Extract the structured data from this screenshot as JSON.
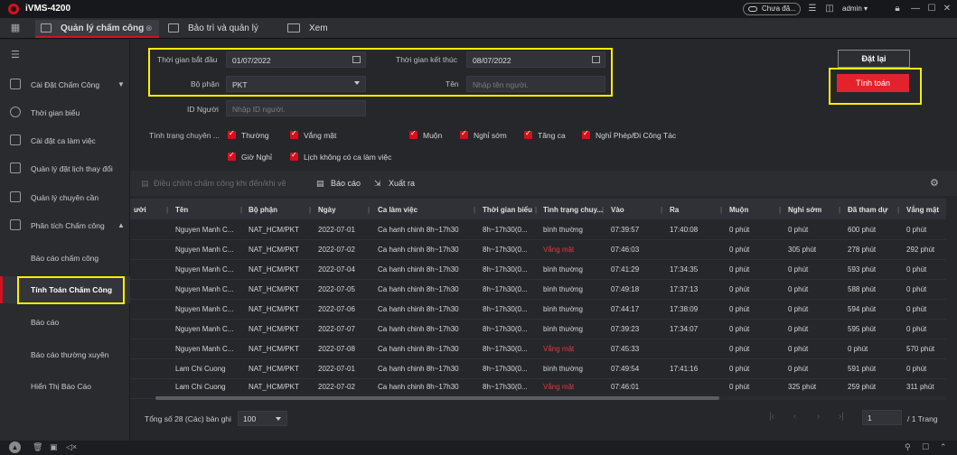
{
  "app": {
    "title": "iVMS-4200"
  },
  "titlebar": {
    "cloud_label": "Chưa đă...",
    "user": "admin"
  },
  "tabs": [
    {
      "label": "Quản lý chấm công"
    },
    {
      "label": "Bảo trì và quản lý"
    },
    {
      "label": "Xem"
    }
  ],
  "sidebar": {
    "items": [
      {
        "label": "Cài Đặt Chấm Công"
      },
      {
        "label": "Thời gian biểu"
      },
      {
        "label": "Cài đặt ca làm việc"
      },
      {
        "label": "Quản lý đặt lịch thay đổi"
      },
      {
        "label": "Quản lý chuyên cần"
      },
      {
        "label": "Phân tích Chấm công"
      },
      {
        "label": "Báo cáo chấm công"
      },
      {
        "label": "Tính Toán Chấm Công"
      },
      {
        "label": "Báo cáo"
      },
      {
        "label": "Báo cáo thường xuyên"
      },
      {
        "label": "Hiển Thị Báo Cáo"
      }
    ]
  },
  "filters": {
    "start_label": "Thời gian bắt đầu",
    "start_value": "01/07/2022",
    "end_label": "Thời gian kết thúc",
    "end_value": "08/07/2022",
    "dept_label": "Bộ phận",
    "dept_value": "PKT",
    "name_label": "Tên",
    "name_placeholder": "Nhập tên người.",
    "id_label": "ID Người",
    "id_placeholder": "Nhập ID người.",
    "status_label": "Tình trạng chuyên ...",
    "checks": [
      "Thường",
      "Vắng mặt",
      "Muộn",
      "Nghỉ sớm",
      "Tăng ca",
      "Nghỉ Phép/Đi Công Tác",
      "Giờ Nghỉ",
      "Lịch không có ca làm việc"
    ]
  },
  "buttons": {
    "reset": "Đặt lại",
    "calculate": "Tính toán"
  },
  "toolbar": {
    "adjust": "Điều chỉnh chấm công khi đến/khi về",
    "report": "Báo cáo",
    "export": "Xuất ra"
  },
  "table": {
    "headers": [
      "ười",
      "Tên",
      "Bộ phận",
      "Ngày",
      "Ca làm việc",
      "Thời gian biểu",
      "Tình trạng chuy...",
      "Vào",
      "Ra",
      "Muộn",
      "Nghỉ sớm",
      "Đã tham dự",
      "Vắng mặt"
    ],
    "rows": [
      [
        "Nguyen Manh C...",
        "NAT_HCM/PKT",
        "2022-07-01",
        "Ca hanh chinh 8h~17h30",
        "8h~17h30(0...",
        "bình thường",
        "07:39:57",
        "17:40:08",
        "0 phút",
        "0 phút",
        "600 phút",
        "0 phút"
      ],
      [
        "Nguyen Manh C...",
        "NAT_HCM/PKT",
        "2022-07-02",
        "Ca hanh chinh 8h~17h30",
        "8h~17h30(0...",
        "Vắng mặt",
        "07:46:03",
        "",
        "0 phút",
        "305 phút",
        "278 phút",
        "292 phút"
      ],
      [
        "Nguyen Manh C...",
        "NAT_HCM/PKT",
        "2022-07-04",
        "Ca hanh chinh 8h~17h30",
        "8h~17h30(0...",
        "bình thường",
        "07:41:29",
        "17:34:35",
        "0 phút",
        "0 phút",
        "593 phút",
        "0 phút"
      ],
      [
        "Nguyen Manh C...",
        "NAT_HCM/PKT",
        "2022-07-05",
        "Ca hanh chinh 8h~17h30",
        "8h~17h30(0...",
        "bình thường",
        "07:49:18",
        "17:37:13",
        "0 phút",
        "0 phút",
        "588 phút",
        "0 phút"
      ],
      [
        "Nguyen Manh C...",
        "NAT_HCM/PKT",
        "2022-07-06",
        "Ca hanh chinh 8h~17h30",
        "8h~17h30(0...",
        "bình thường",
        "07:44:17",
        "17:38:09",
        "0 phút",
        "0 phút",
        "594 phút",
        "0 phút"
      ],
      [
        "Nguyen Manh C...",
        "NAT_HCM/PKT",
        "2022-07-07",
        "Ca hanh chinh 8h~17h30",
        "8h~17h30(0...",
        "bình thường",
        "07:39:23",
        "17:34:07",
        "0 phút",
        "0 phút",
        "595 phút",
        "0 phút"
      ],
      [
        "Nguyen Manh C...",
        "NAT_HCM/PKT",
        "2022-07-08",
        "Ca hanh chinh 8h~17h30",
        "8h~17h30(0...",
        "Vắng mặt",
        "07:45:33",
        "",
        "0 phút",
        "0 phút",
        "0 phút",
        "570 phút"
      ],
      [
        "Lam Chi Cuong",
        "NAT_HCM/PKT",
        "2022-07-01",
        "Ca hanh chinh 8h~17h30",
        "8h~17h30(0...",
        "bình thường",
        "07:49:54",
        "17:41:16",
        "0 phút",
        "0 phút",
        "591 phút",
        "0 phút"
      ],
      [
        "Lam Chi Cuong",
        "NAT_HCM/PKT",
        "2022-07-02",
        "Ca hanh chinh 8h~17h30",
        "8h~17h30(0...",
        "Vắng mặt",
        "07:46:01",
        "",
        "0 phút",
        "325 phút",
        "259 phút",
        "311 phút"
      ]
    ]
  },
  "footer": {
    "total": "Tổng số 28 (Các) bản ghi",
    "page_size": "100",
    "page": "1",
    "page_total": "/ 1 Trang"
  },
  "colors": {
    "accent": "#e2232b",
    "highlight": "#ffee00",
    "absent_text": "#e5383f"
  }
}
